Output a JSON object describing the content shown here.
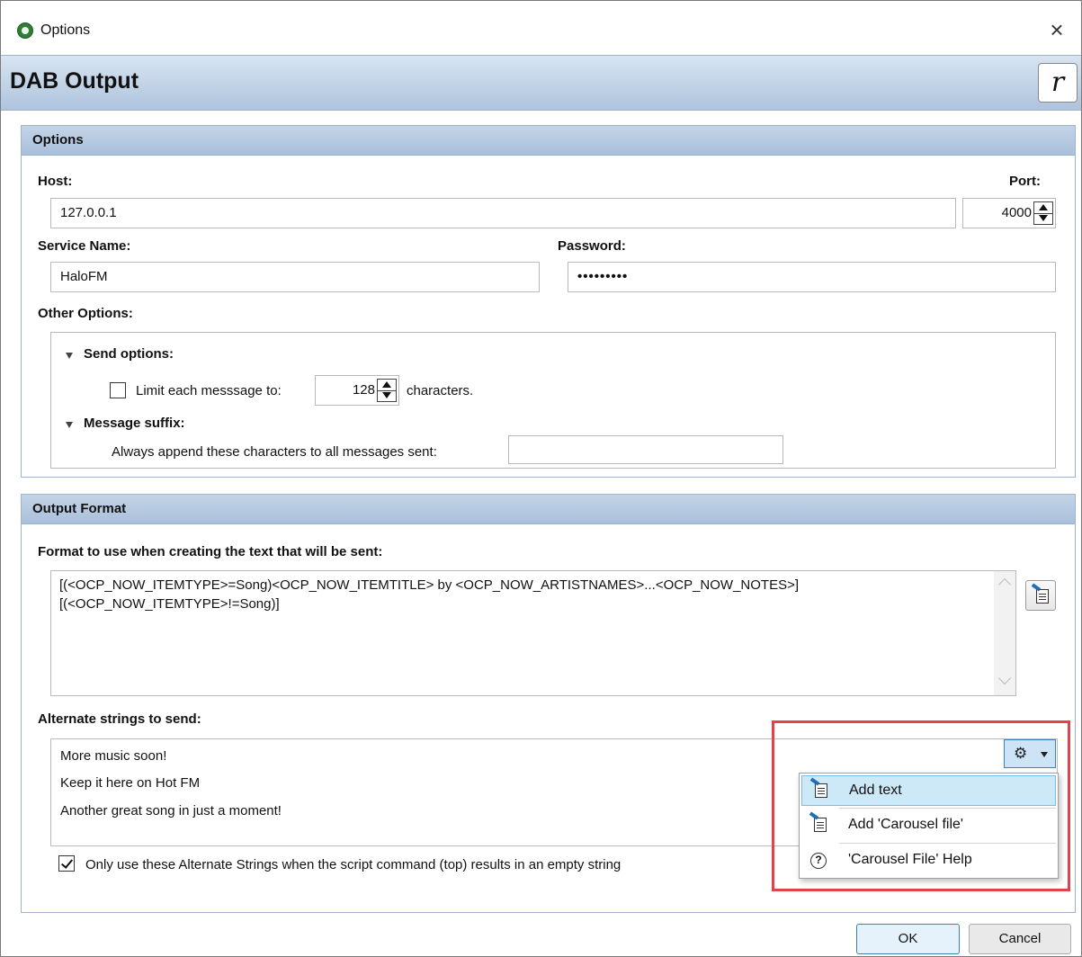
{
  "window": {
    "title": "Options",
    "close_glyph": "×"
  },
  "header": {
    "title": "DAB Output",
    "logo_letter": "r"
  },
  "options_panel": {
    "heading": "Options",
    "host_label": "Host:",
    "host_value": "127.0.0.1",
    "port_label": "Port:",
    "port_value": "4000",
    "service_name_label": "Service Name:",
    "service_name_value": "HaloFM",
    "password_label": "Password:",
    "password_value": "•••••••••",
    "other_options_label": "Other Options:",
    "send_options_label": "Send options:",
    "limit_label": "Limit each messsage to:",
    "limit_value": "128",
    "limit_checked": false,
    "characters_label": "characters.",
    "message_suffix_label": "Message suffix:",
    "suffix_description": "Always append these characters to all messages sent:",
    "suffix_value": ""
  },
  "output_panel": {
    "heading": "Output Format",
    "format_label": "Format to use when creating the text that will be sent:",
    "format_lines": [
      "[(<OCP_NOW_ITEMTYPE>=Song)<OCP_NOW_ITEMTITLE> by <OCP_NOW_ARTISTNAMES>...<OCP_NOW_NOTES>]",
      "[(<OCP_NOW_ITEMTYPE>!=Song)]"
    ],
    "alternate_label": "Alternate strings to send:",
    "alternate_strings": [
      "More music soon!",
      "Keep it here on Hot FM",
      "Another great song in just a moment!"
    ],
    "only_use_label": "Only use these Alternate Strings when the script command (top) results in an empty string",
    "only_use_checked": true
  },
  "dropdown_menu": {
    "items": [
      {
        "label": "Add text",
        "icon": "edit-doc-icon"
      },
      {
        "label": "Add 'Carousel file'",
        "icon": "edit-doc-icon"
      },
      {
        "label": "'Carousel File' Help",
        "icon": "help-icon"
      }
    ]
  },
  "footer": {
    "ok_label": "OK",
    "cancel_label": "Cancel"
  },
  "colors": {
    "header_band": "#aec4dd",
    "highlight": "#e2434b",
    "menu_hover": "#cde8f7"
  }
}
